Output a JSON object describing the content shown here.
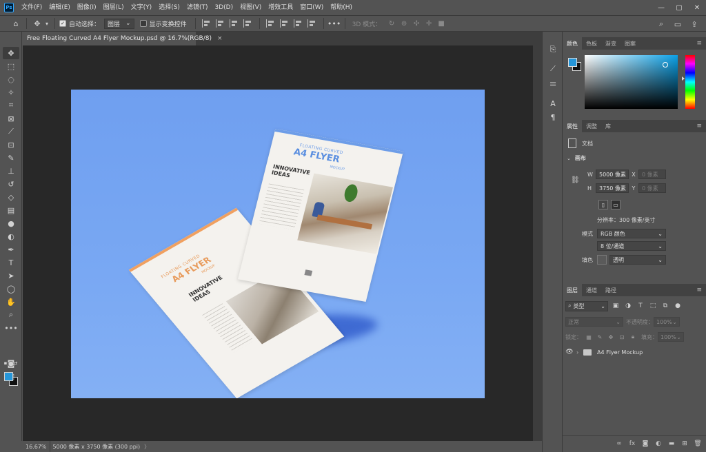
{
  "app": {
    "logo": "Ps"
  },
  "menu": [
    "文件(F)",
    "编辑(E)",
    "图像(I)",
    "图层(L)",
    "文字(Y)",
    "选择(S)",
    "滤镜(T)",
    "3D(D)",
    "视图(V)",
    "增效工具",
    "窗口(W)",
    "帮助(H)"
  ],
  "window_controls": {
    "minimize": "—",
    "maximize": "▢",
    "close": "✕"
  },
  "options": {
    "auto_select_label": "自动选择：",
    "auto_select_checked": true,
    "auto_select_target": "图层",
    "show_transform_label": "显示变换控件",
    "show_transform_checked": false,
    "more": "•••",
    "mode_3d_label": "3D 模式："
  },
  "document_tab": {
    "title": "Free Floating Curved A4 Flyer Mockup.psd @ 16.7%(RGB/8)",
    "close": "×"
  },
  "canvas": {
    "background_color": "#6f9ff0",
    "flyer_front": {
      "subtitle": "FLOATING CURVED",
      "title": "A4 FLYER",
      "mockup": "MOCKUP",
      "headline": "INNOVATIVE IDEAS"
    },
    "flyer_back": {
      "subtitle": "FLOATING CURVED",
      "title": "A4 FLYER",
      "mockup": "MOCKUP",
      "headline": "INNOVATIVE IDEAS"
    }
  },
  "status": {
    "zoom": "16.67%",
    "info": "5000 像素 x 3750 像素 (300 ppi)",
    "arrow": "〉"
  },
  "color_panel": {
    "tabs": [
      "颜色",
      "色板",
      "渐变",
      "图案"
    ],
    "active_tab": 0,
    "foreground": "#2596d9",
    "background": "#111111"
  },
  "properties_panel": {
    "tabs": [
      "属性",
      "调整",
      "库"
    ],
    "active_tab": 0,
    "doc_label": "文档",
    "canvas_section": "画布",
    "w_label": "W",
    "w_value": "5000 像素",
    "x_label": "X",
    "x_placeholder": "0 像素",
    "h_label": "H",
    "h_value": "3750 像素",
    "y_label": "Y",
    "y_placeholder": "0 像素",
    "resolution": "分辨率：300 像素/英寸",
    "mode_label": "模式",
    "mode_value": "RGB 颜色",
    "bit_depth": "8 位/通道",
    "fill_label": "填色",
    "fill_value": "透明"
  },
  "layers_panel": {
    "tabs": [
      "图层",
      "通道",
      "路径"
    ],
    "active_tab": 0,
    "filter_kind": "类型",
    "blend_mode": "正常",
    "opacity_label": "不透明度：",
    "opacity_value": "100%",
    "lock_label": "锁定：",
    "fill_label": "填充：",
    "fill_value": "100%",
    "layers": [
      {
        "name": "A4 Flyer Mockup",
        "type": "group",
        "visible": true
      }
    ]
  }
}
